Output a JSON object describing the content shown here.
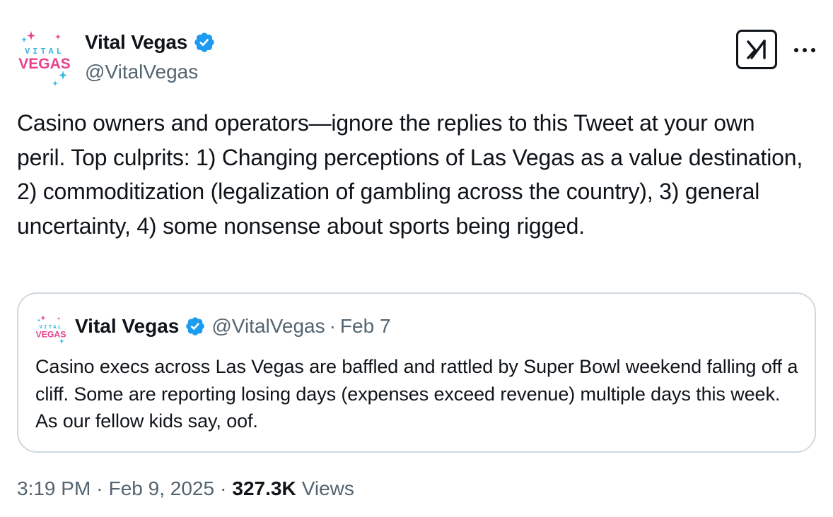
{
  "author": {
    "display_name": "Vital Vegas",
    "handle": "@VitalVegas",
    "verified": true,
    "avatar_text_top": "VITAL",
    "avatar_text_bottom": "VEGAS"
  },
  "icons": {
    "verified": "verified-badge-icon",
    "grok": "grok-icon",
    "more": "more-horizontal-icon"
  },
  "colors": {
    "verified_blue": "#1d9bf0",
    "text": "#0f1419",
    "secondary": "#536471",
    "border": "#cfd9de",
    "avatar_pink": "#e8418f",
    "avatar_cyan": "#35b8e0"
  },
  "tweet": {
    "text": "Casino owners and operators—ignore the replies to this Tweet at your own peril. Top culprits: 1) Changing perceptions of Las Vegas as a value destination, 2) commoditization (legalization of gambling across the country), 3) general uncertainty, 4) some nonsense about sports being rigged."
  },
  "quote": {
    "display_name": "Vital Vegas",
    "handle": "@VitalVegas",
    "separator": "·",
    "date": "Feb 7",
    "text": "Casino execs across Las Vegas are baffled and rattled by Super Bowl weekend falling off a cliff. Some are reporting losing days (expenses exceed revenue) multiple days this week. As our fellow kids say, oof."
  },
  "meta": {
    "time": "3:19 PM",
    "separator": "·",
    "date": "Feb 9, 2025",
    "views_count": "327.3K",
    "views_label": "Views"
  }
}
